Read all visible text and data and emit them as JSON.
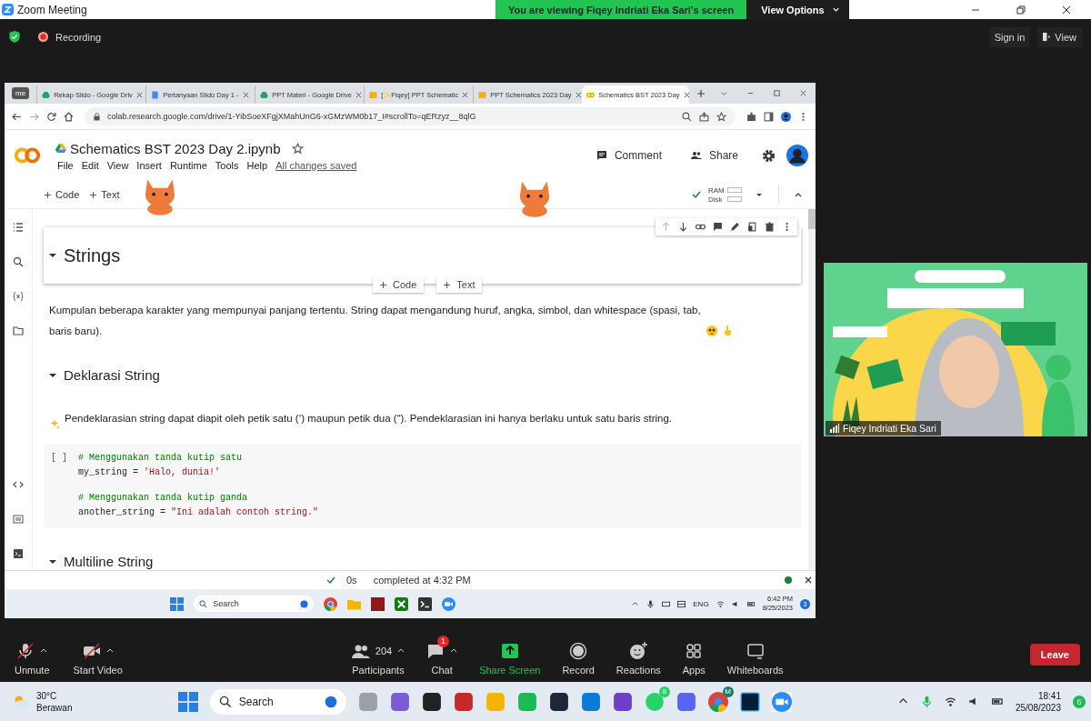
{
  "zoom_window": {
    "title": "Zoom Meeting",
    "banner": "You are viewing Fiqey Indriati Eka Sari's screen",
    "view_options": "View Options"
  },
  "meeting_bar": {
    "recording": "Recording",
    "sign_in": "Sign in",
    "view": "View"
  },
  "shared_screen": {
    "browser": {
      "profile": "me",
      "tabs": [
        {
          "label": "Rekap Slido - Google Driv",
          "selected": false
        },
        {
          "label": "Pertanyaan Slido Day 1 -",
          "selected": false
        },
        {
          "label": "PPT Materi - Google Drive",
          "selected": false
        },
        {
          "label": "[✨Fiqey] PPT Schematic",
          "selected": false
        },
        {
          "label": "PPT Schematics 2023 Day",
          "selected": false
        },
        {
          "label": "Schematics BST 2023 Day",
          "selected": true
        }
      ],
      "url": "colab.research.google.com/drive/1-YibSoeXFgjXMahUnG6-xGMzWM0b17_I#scrollTo=qERzyz__8qlG"
    },
    "notebook": {
      "title": "Schematics BST 2023 Day 2.ipynb",
      "menu": [
        "File",
        "Edit",
        "View",
        "Insert",
        "Runtime",
        "Tools",
        "Help"
      ],
      "saved_status": "All changes saved",
      "comment": "Comment",
      "share": "Share",
      "add_code": "Code",
      "add_text": "Text",
      "ram": "RAM",
      "disk": "Disk",
      "cells": [
        {
          "kind": "heading",
          "text": "Strings",
          "selected": true,
          "add_code": "Code",
          "add_text": "Text"
        },
        {
          "kind": "text",
          "text": "Kumpulan beberapa karakter yang mempunyai panjang tertentu. String dapat mengandung huruf, angka, simbol, dan whitespace (spasi, tab, baris baru)."
        },
        {
          "kind": "subheading",
          "text": "Deklarasi String"
        },
        {
          "kind": "tip",
          "text": "Pendeklarasian string dapat diapit oleh petik satu (‘) maupun petik dua (“). Pendeklarasian ini hanya berlaku untuk satu baris string."
        },
        {
          "kind": "code",
          "run_marker": "[ ]",
          "lines": [
            [
              {
                "kind": "comment",
                "text": "# Menggunakan tanda kutip satu"
              }
            ],
            [
              {
                "kind": "plain",
                "text": "my_string = "
              },
              {
                "kind": "string",
                "text": "'Halo, dunia!'"
              }
            ],
            [
              {
                "kind": "comment",
                "text": "# Menggunakan tanda kutip ganda"
              }
            ],
            [
              {
                "kind": "plain",
                "text": "another_string = "
              },
              {
                "kind": "string",
                "text": "\"Ini adalah contoh string.\""
              }
            ]
          ]
        },
        {
          "kind": "subheading",
          "text": "Multiline String"
        }
      ],
      "status": {
        "duration": "0s",
        "completed": "completed at 4:32 PM"
      }
    },
    "taskbar": {
      "search": "Search",
      "language": "ENG",
      "time": "6:42 PM",
      "date": "8/25/2023",
      "notification_count": "3"
    }
  },
  "video": {
    "name": "Fiqey Indriati Eka Sari"
  },
  "controls": [
    {
      "kind": "mic",
      "label": "Unmute",
      "muted": true
    },
    {
      "kind": "camera",
      "label": "Start Video",
      "muted": true
    },
    {
      "kind": "participants",
      "label": "Participants",
      "count": "204"
    },
    {
      "kind": "chat",
      "label": "Chat",
      "badge": "1"
    },
    {
      "kind": "share",
      "label": "Share Screen"
    },
    {
      "kind": "record",
      "label": "Record"
    },
    {
      "kind": "reactions",
      "label": "Reactions"
    },
    {
      "kind": "apps",
      "label": "Apps"
    },
    {
      "kind": "whiteboards",
      "label": "Whiteboards"
    }
  ],
  "leave": "Leave",
  "taskbar": {
    "temperature": "30°C",
    "weather": "Berawan",
    "search": "Search",
    "whatsapp_badge": "8",
    "chrome_badge": "M",
    "time": "18:41",
    "date": "25/08/2023",
    "notification_count": "6"
  }
}
